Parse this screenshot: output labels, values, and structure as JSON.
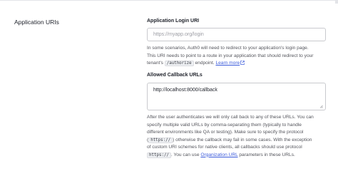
{
  "section": {
    "title": "Application URIs"
  },
  "login_uri": {
    "label": "Application Login URI",
    "placeholder": "https://myapp.org/login",
    "help": {
      "line1": "In some scenarios, Auth0 will need to redirect to your application's login page.",
      "line2": "This URI needs to point to a route in your application that should redirect to your",
      "line3_pre": "tenant's",
      "line3_code": "/authorize",
      "line3_mid": "endpoint.",
      "line3_link": "Learn more"
    }
  },
  "callbacks": {
    "label": "Allowed Callback URLs",
    "value": "http://localhost:8000/callback",
    "help": {
      "line1": "After the user authenticates we will only call back to any of these URLs. You can",
      "line2": "specify multiple valid URLs by comma-separating them (typically to handle",
      "line3": "different environments like QA or testing). Make sure to specify the protocol",
      "line4_pre": "(",
      "line4_code": "https://",
      "line4_post": ") otherwise the callback may fail in some cases. With the exception",
      "line5": "of custom URI schemes for native clients, all callbacks should use protocol",
      "line6_code": "https://",
      "line6_mid": ". You can use",
      "line6_link": "Organization URL",
      "line6_post": "parameters in these URLs."
    }
  },
  "icons": {
    "external_link": "external-link-icon",
    "resize": "resize-grip-icon"
  }
}
